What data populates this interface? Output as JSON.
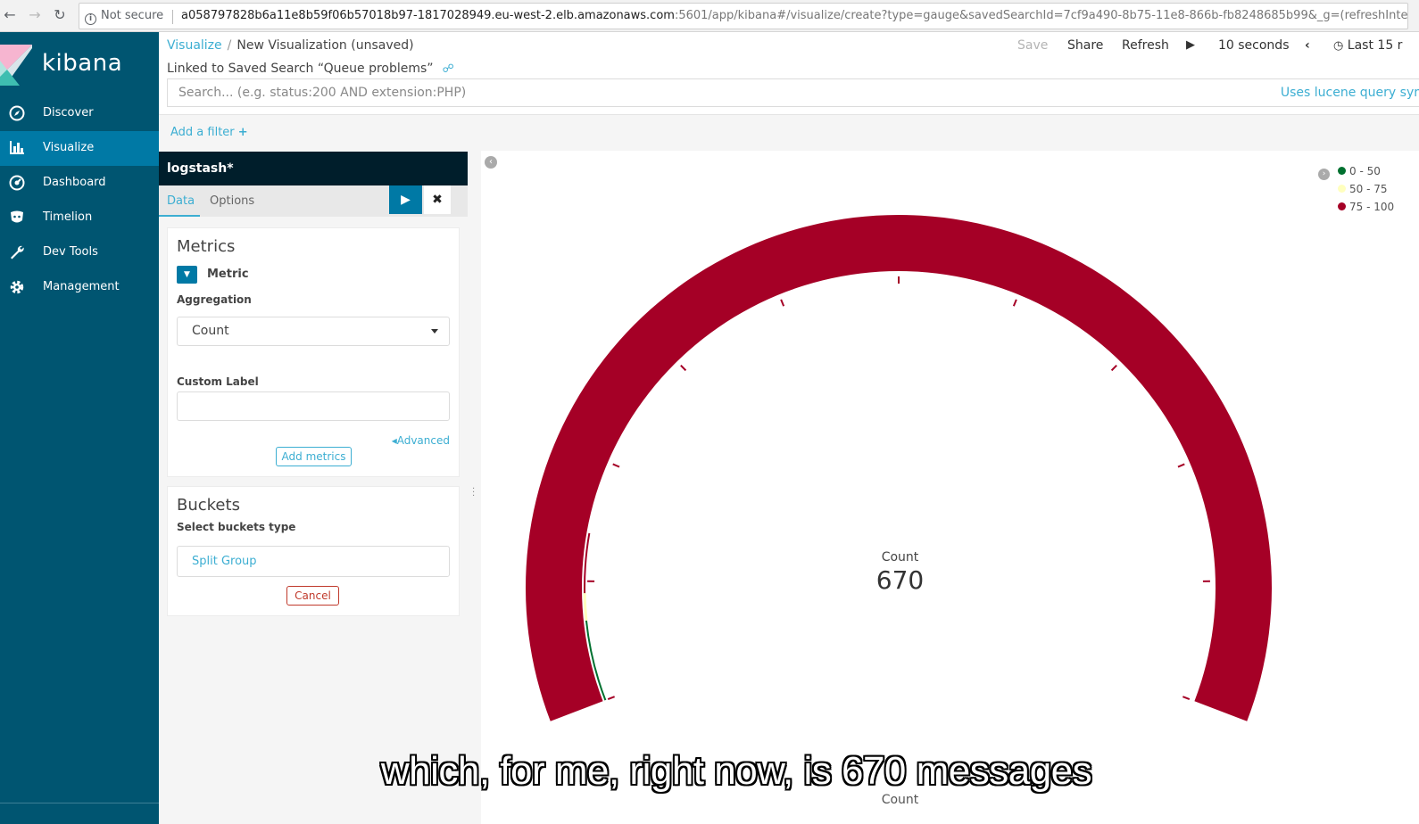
{
  "browser": {
    "security_label": "Not secure",
    "url_host": "a058797828b6a11e8b59f06b57018b97-1817028949.eu-west-2.elb.amazonaws.com",
    "url_rest": ":5601/app/kibana#/visualize/create?type=gauge&savedSearchId=7cf9a490-8b75-11e8-866b-fb8248685b99&_g=(refreshInterv..."
  },
  "app": {
    "name": "kibana"
  },
  "sidebar": {
    "items": [
      {
        "label": "Discover",
        "icon": "compass-icon"
      },
      {
        "label": "Visualize",
        "icon": "bar-chart-icon",
        "active": true
      },
      {
        "label": "Dashboard",
        "icon": "dashboard-icon"
      },
      {
        "label": "Timelion",
        "icon": "timelion-icon"
      },
      {
        "label": "Dev Tools",
        "icon": "wrench-icon"
      },
      {
        "label": "Management",
        "icon": "gear-icon"
      }
    ]
  },
  "header": {
    "breadcrumb_link": "Visualize",
    "breadcrumb_sep": "/",
    "breadcrumb_current": "New Visualization (unsaved)",
    "linked_search": "Linked to Saved Search “Queue problems”",
    "actions": {
      "save": "Save",
      "share": "Share",
      "refresh": "Refresh",
      "interval": "10 seconds",
      "time": "Last 15 r"
    }
  },
  "search": {
    "placeholder": "Search... (e.g. status:200 AND extension:PHP)",
    "lucene": "Uses lucene query syr"
  },
  "filter": {
    "add_label": "Add a filter"
  },
  "editor": {
    "index": "logstash*",
    "tabs": [
      "Data",
      "Options"
    ],
    "metrics": {
      "title": "Metrics",
      "metric_label": "Metric",
      "aggregation_label": "Aggregation",
      "aggregation_value": "Count",
      "custom_label": "Custom Label",
      "advanced": "Advanced",
      "add_metrics": "Add metrics"
    },
    "buckets": {
      "title": "Buckets",
      "select_type": "Select buckets type",
      "split_group": "Split Group",
      "cancel": "Cancel"
    }
  },
  "gauge": {
    "label": "Count",
    "value": "670",
    "axis_label": "Count",
    "ranges": [
      {
        "label": "0 - 50",
        "color": "#00702f"
      },
      {
        "label": "50 - 75",
        "color": "#ffffbe"
      },
      {
        "label": "75 - 100",
        "color": "#a50026"
      }
    ]
  },
  "caption": "which, for me, right now, is 670 messages"
}
